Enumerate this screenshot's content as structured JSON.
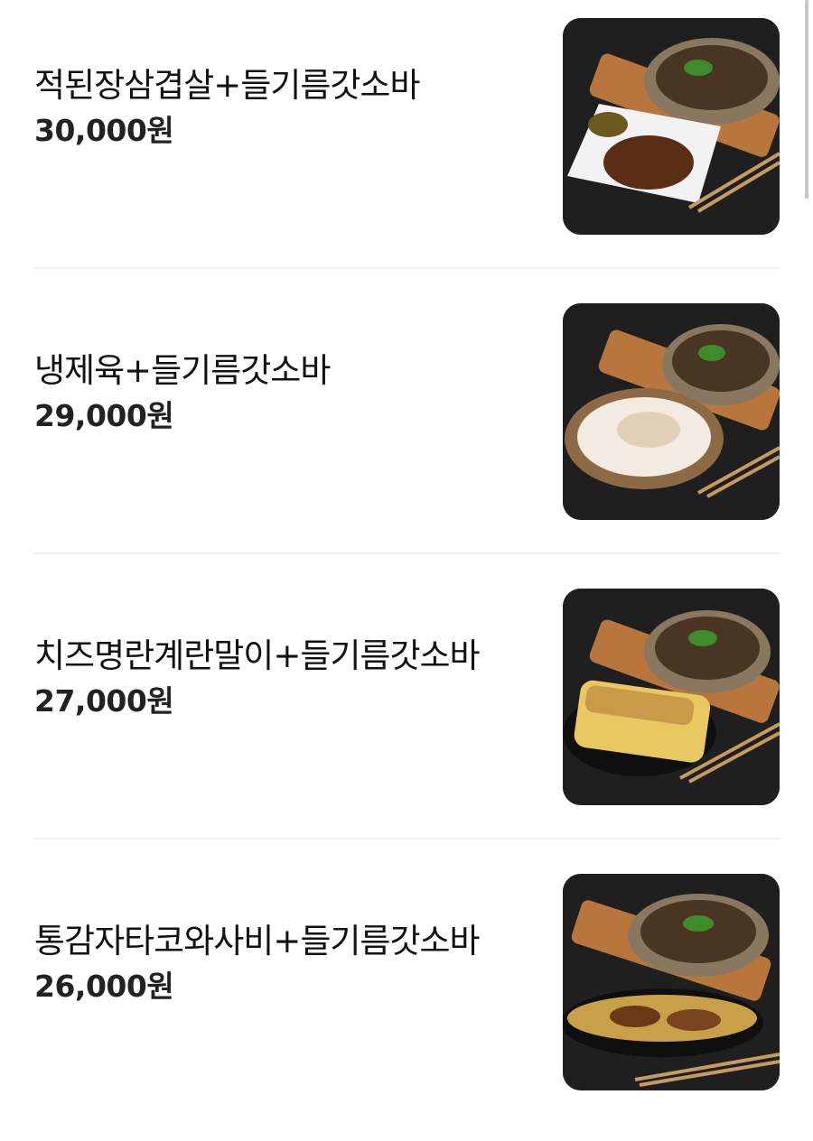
{
  "menu": {
    "items": [
      {
        "name": "적된장삼겹살+들기름갓소바",
        "price": "30,000원",
        "side_dish": "pork-belly"
      },
      {
        "name": "냉제육+들기름갓소바",
        "price": "29,000원",
        "side_dish": "sliced-pork"
      },
      {
        "name": "치즈명란계란말이+들기름갓소바",
        "price": "27,000원",
        "side_dish": "egg-roll"
      },
      {
        "name": "통감자타코와사비+들기름갓소바",
        "price": "26,000원",
        "side_dish": "potato-tako"
      }
    ]
  },
  "colors": {
    "text": "#111111",
    "price": "#222222",
    "divider": "#f0f0f0",
    "photo_bg": "#1d1d1d"
  }
}
